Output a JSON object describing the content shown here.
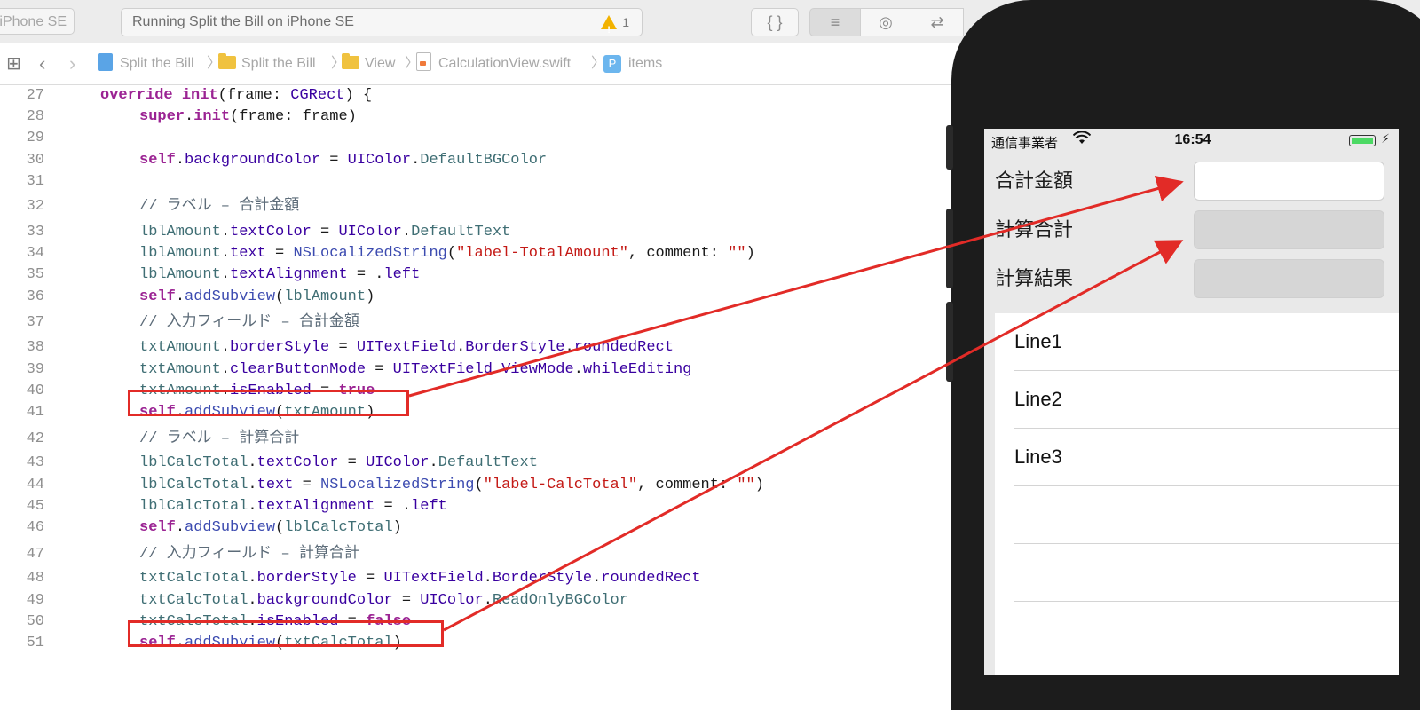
{
  "toolbar": {
    "device_label": "iPhone SE",
    "status_text": "Running Split the Bill on iPhone SE",
    "warning_count": "1",
    "braces_label": "{ }"
  },
  "jumpbar": {
    "crumbs": [
      "Split the Bill",
      "Split the Bill",
      "View",
      "CalculationView.swift",
      "items"
    ],
    "separator": "〉",
    "p_badge": "P"
  },
  "editor": {
    "line_numbers": [
      "27",
      "28",
      "29",
      "30",
      "31",
      "32",
      "33",
      "34",
      "35",
      "36",
      "37",
      "38",
      "39",
      "40",
      "41",
      "42",
      "43",
      "44",
      "45",
      "46",
      "47",
      "48",
      "49",
      "50",
      "51"
    ],
    "l27": [
      "override",
      " ",
      "init",
      "(frame: ",
      "CGRect",
      ") {"
    ],
    "l28": [
      "super",
      ".",
      "init",
      "(frame: frame)"
    ],
    "l30": [
      "self",
      ".",
      "backgroundColor",
      " = ",
      "UIColor",
      ".",
      "DefaultBGColor"
    ],
    "l32": "// ラベル – 合計金額",
    "l33": [
      "lblAmount",
      ".",
      "textColor",
      " = ",
      "UIColor",
      ".",
      "DefaultText"
    ],
    "l34": [
      "lblAmount",
      ".",
      "text",
      " = ",
      "NSLocalizedString",
      "(",
      "\"label-TotalAmount\"",
      ", comment: ",
      "\"\"",
      ")"
    ],
    "l35": [
      "lblAmount",
      ".",
      "textAlignment",
      " = .",
      "left"
    ],
    "l36": [
      "self",
      ".",
      "addSubview",
      "(",
      "lblAmount",
      ")"
    ],
    "l37": "// 入力フィールド – 合計金額",
    "l38": [
      "txtAmount",
      ".",
      "borderStyle",
      " = ",
      "UITextField",
      ".",
      "BorderStyle",
      ".",
      "roundedRect"
    ],
    "l39": [
      "txtAmount",
      ".",
      "clearButtonMode",
      " = ",
      "UITextField",
      ".",
      "ViewMode",
      ".",
      "whileEditing"
    ],
    "l40": [
      "txtAmount",
      ".",
      "isEnabled",
      " = ",
      "true"
    ],
    "l41": [
      "self",
      ".",
      "addSubview",
      "(",
      "txtAmount",
      ")"
    ],
    "l42": "// ラベル – 計算合計",
    "l43": [
      "lblCalcTotal",
      ".",
      "textColor",
      " = ",
      "UIColor",
      ".",
      "DefaultText"
    ],
    "l44": [
      "lblCalcTotal",
      ".",
      "text",
      " = ",
      "NSLocalizedString",
      "(",
      "\"label-CalcTotal\"",
      ", comment: ",
      "\"\"",
      ")"
    ],
    "l45": [
      "lblCalcTotal",
      ".",
      "textAlignment",
      " = .",
      "left"
    ],
    "l46": [
      "self",
      ".",
      "addSubview",
      "(",
      "lblCalcTotal",
      ")"
    ],
    "l47": "// 入力フィールド – 計算合計",
    "l48": [
      "txtCalcTotal",
      ".",
      "borderStyle",
      " = ",
      "UITextField",
      ".",
      "BorderStyle",
      ".",
      "roundedRect"
    ],
    "l49": [
      "txtCalcTotal",
      ".",
      "backgroundColor",
      " = ",
      "UIColor",
      ".",
      "ReadOnlyBGColor"
    ],
    "l50": [
      "txtCalcTotal",
      ".",
      "isEnabled",
      " = ",
      "false"
    ],
    "l51": [
      "self",
      ".",
      "addSubview",
      "(",
      "txtCalcTotal",
      ")"
    ]
  },
  "simulator": {
    "carrier": "通信事業者",
    "time": "16:54",
    "form": {
      "total_amount_label": "合計金額",
      "calc_total_label": "計算合計",
      "calc_result_label": "計算結果"
    },
    "table_rows": [
      "Line1",
      "Line2",
      "Line3"
    ]
  },
  "colors": {
    "keyword": "#9b2393",
    "type": "#3900a0",
    "property": "#3f6e74",
    "string": "#c41a16",
    "annotation_red": "#e22b27"
  }
}
